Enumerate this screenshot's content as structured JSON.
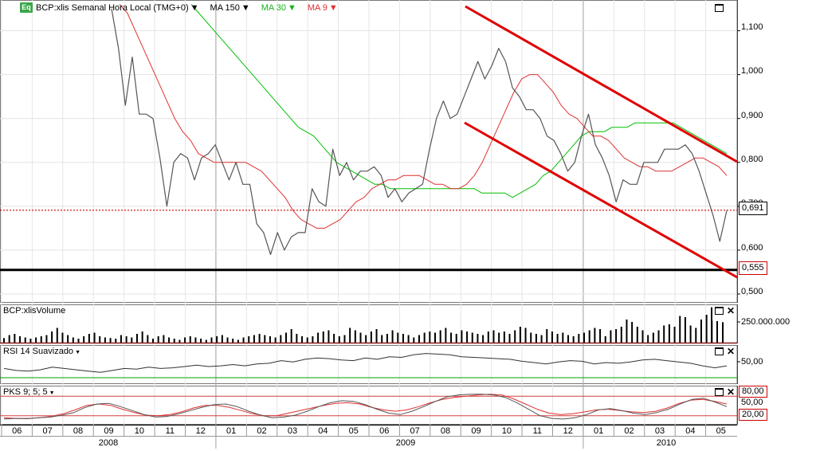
{
  "price_panel": {
    "instrument": "BCP:xlis Semanal Hora Local (TMG+0)",
    "ma150_label": "MA 150",
    "ma30_label": "MA 30",
    "ma9_label": "MA 9",
    "eq_badge": "Eq",
    "last_price": "0,691",
    "support_level": "0,555",
    "yticks": [
      "1,100",
      "1,000",
      "0,900",
      "0,800",
      "0,700",
      "0,600",
      "0,500"
    ]
  },
  "volume_panel": {
    "title": "BCP:xlisVolume",
    "ytick": "250.000.000"
  },
  "rsi_panel": {
    "title": "RSI 14 Suavizado",
    "ytick": "50,00"
  },
  "pks_panel": {
    "title": "PKS 9; 5; 5",
    "ytick_high": "80,00",
    "ytick_mid": "50,00",
    "ytick_low": "20,00"
  },
  "time_axis": {
    "months": [
      "06",
      "07",
      "08",
      "09",
      "10",
      "11",
      "12",
      "01",
      "02",
      "03",
      "04",
      "05",
      "06",
      "07",
      "08",
      "09",
      "10",
      "11",
      "12",
      "01",
      "02",
      "03",
      "04",
      "05"
    ],
    "years": [
      "2008",
      "2009",
      "2010"
    ]
  },
  "colors": {
    "price": "#555555",
    "ma30": "#00c000",
    "ma9": "#e03030",
    "channel": "#e00000",
    "support": "#000000",
    "last_price": "#cc0000",
    "volume": "#000000",
    "rsi": "#333333",
    "pks_fast": "#555555",
    "pks_slow": "#e03030"
  },
  "chart_data": [
    {
      "type": "line",
      "title": "BCP:xlis Semanal Hora Local (TMG+0)",
      "ylim": [
        0.48,
        1.17
      ],
      "grid": true,
      "series": [
        {
          "name": "BCP:xlis",
          "values": [
            1.15,
            1.06,
            0.93,
            1.04,
            0.91,
            0.91,
            0.9,
            0.81,
            0.7,
            0.8,
            0.82,
            0.81,
            0.76,
            0.81,
            0.82,
            0.84,
            0.8,
            0.76,
            0.8,
            0.75,
            0.75,
            0.66,
            0.64,
            0.59,
            0.64,
            0.6,
            0.63,
            0.64,
            0.64,
            0.74,
            0.71,
            0.7,
            0.83,
            0.77,
            0.8,
            0.76,
            0.78,
            0.78,
            0.79,
            0.77,
            0.72,
            0.74,
            0.71,
            0.73,
            0.74,
            0.75,
            0.83,
            0.9,
            0.94,
            0.9,
            0.91,
            0.95,
            0.99,
            1.03,
            0.99,
            1.02,
            1.06,
            1.03,
            0.97,
            0.95,
            0.92,
            0.92,
            0.9,
            0.86,
            0.85,
            0.82,
            0.78,
            0.8,
            0.86,
            0.91,
            0.84,
            0.81,
            0.77,
            0.71,
            0.76,
            0.75,
            0.75,
            0.8,
            0.8,
            0.8,
            0.83,
            0.83,
            0.83,
            0.84,
            0.82,
            0.78,
            0.73,
            0.68,
            0.62,
            0.69
          ]
        },
        {
          "name": "MA 30",
          "values": [
            1.16,
            1.14,
            1.12,
            1.1,
            1.08,
            1.06,
            1.04,
            1.02,
            1.0,
            0.98,
            0.96,
            0.94,
            0.92,
            0.9,
            0.88,
            0.87,
            0.86,
            0.84,
            0.82,
            0.8,
            0.79,
            0.78,
            0.77,
            0.76,
            0.75,
            0.75,
            0.74,
            0.74,
            0.74,
            0.74,
            0.74,
            0.74,
            0.74,
            0.74,
            0.74,
            0.74,
            0.74,
            0.74,
            0.73,
            0.73,
            0.73,
            0.73,
            0.72,
            0.73,
            0.74,
            0.75,
            0.77,
            0.78,
            0.8,
            0.82,
            0.84,
            0.86,
            0.87,
            0.87,
            0.87,
            0.88,
            0.88,
            0.88,
            0.89,
            0.89,
            0.89,
            0.89,
            0.89,
            0.89,
            0.88,
            0.87,
            0.86,
            0.85,
            0.84,
            0.83,
            0.82
          ]
        },
        {
          "name": "MA 9",
          "values": [
            1.16,
            1.14,
            1.1,
            1.06,
            1.02,
            0.98,
            0.94,
            0.9,
            0.87,
            0.85,
            0.82,
            0.81,
            0.8,
            0.8,
            0.8,
            0.8,
            0.8,
            0.79,
            0.78,
            0.76,
            0.74,
            0.72,
            0.69,
            0.67,
            0.66,
            0.65,
            0.65,
            0.66,
            0.67,
            0.69,
            0.71,
            0.72,
            0.74,
            0.75,
            0.76,
            0.76,
            0.77,
            0.77,
            0.77,
            0.76,
            0.75,
            0.75,
            0.74,
            0.74,
            0.75,
            0.77,
            0.8,
            0.84,
            0.88,
            0.92,
            0.96,
            0.99,
            1.0,
            1.0,
            0.98,
            0.96,
            0.93,
            0.91,
            0.9,
            0.88,
            0.86,
            0.86,
            0.85,
            0.83,
            0.81,
            0.8,
            0.79,
            0.79,
            0.78,
            0.78,
            0.78,
            0.79,
            0.8,
            0.81,
            0.81,
            0.8,
            0.79,
            0.77
          ]
        }
      ]
    },
    {
      "type": "bar",
      "title": "BCP:xlisVolume",
      "values": [
        9,
        14,
        16,
        12,
        10,
        8,
        10,
        12,
        14,
        20,
        26,
        18,
        14,
        10,
        8,
        12,
        16,
        18,
        12,
        10,
        9,
        8,
        14,
        12,
        10,
        16,
        20,
        14,
        8,
        12,
        14,
        10,
        8,
        6,
        10,
        12,
        10,
        8,
        6,
        10,
        12,
        14,
        10,
        8,
        6,
        10,
        12,
        14,
        16,
        14,
        12,
        10,
        14,
        18,
        24,
        16,
        12,
        10,
        12,
        18,
        20,
        22,
        16,
        12,
        14,
        26,
        22,
        18,
        14,
        20,
        24,
        14,
        16,
        22,
        18,
        16,
        14,
        10,
        14,
        18,
        20,
        18,
        22,
        26,
        18,
        16,
        22,
        20,
        18,
        16,
        14,
        20,
        22,
        18,
        20,
        16,
        22,
        28,
        26,
        18,
        16,
        14,
        24,
        20,
        16,
        18,
        14,
        12,
        16,
        18,
        22,
        26,
        24,
        12,
        22,
        24,
        28,
        40,
        36,
        28,
        22,
        14,
        18,
        22,
        30,
        32,
        28,
        46,
        44,
        30,
        26,
        40,
        48,
        38,
        32
      ],
      "peaks": [
        340,
        210,
        200
      ]
    },
    {
      "type": "line",
      "title": "RSI 14 Suavizado",
      "ylim": [
        0,
        100
      ],
      "series": [
        {
          "name": "RSI 14 Suavizado",
          "values": [
            38,
            32,
            30,
            34,
            42,
            38,
            34,
            30,
            26,
            32,
            38,
            36,
            42,
            38,
            40,
            44,
            48,
            44,
            46,
            50,
            46,
            52,
            54,
            62,
            58,
            66,
            70,
            68,
            64,
            62,
            70,
            66,
            74,
            72,
            80,
            84,
            82,
            80,
            74,
            72,
            70,
            68,
            66,
            60,
            56,
            52,
            58,
            62,
            60,
            52,
            56,
            54,
            58,
            64,
            66,
            62,
            58,
            54,
            46,
            40,
            46
          ]
        }
      ]
    },
    {
      "type": "line",
      "title": "PKS 9; 5; 5",
      "ylim": [
        0,
        100
      ],
      "series": [
        {
          "name": "PKS 9; 5; 5",
          "values": [
            10,
            12,
            11,
            14,
            16,
            22,
            30,
            46,
            56,
            58,
            48,
            36,
            24,
            16,
            18,
            26,
            36,
            46,
            54,
            56,
            48,
            34,
            22,
            14,
            16,
            22,
            34,
            48,
            60,
            66,
            64,
            54,
            40,
            28,
            24,
            34,
            48,
            64,
            78,
            84,
            86,
            86,
            84,
            76,
            60,
            40,
            20,
            12,
            10,
            14,
            24,
            38,
            42,
            36,
            28,
            24,
            30,
            40,
            56,
            70,
            74,
            62,
            48
          ]
        },
        {
          "name": "",
          "values": [
            14,
            12,
            12,
            14,
            18,
            26,
            38,
            52,
            56,
            52,
            40,
            30,
            22,
            20,
            24,
            32,
            44,
            52,
            52,
            46,
            36,
            26,
            20,
            20,
            28,
            36,
            44,
            52,
            58,
            60,
            56,
            46,
            38,
            34,
            38,
            48,
            60,
            70,
            76,
            80,
            84,
            86,
            84,
            72,
            56,
            40,
            28,
            24,
            26,
            32,
            38,
            40,
            36,
            32,
            30,
            34,
            44,
            58,
            68,
            70,
            64,
            56
          ]
        }
      ]
    }
  ]
}
